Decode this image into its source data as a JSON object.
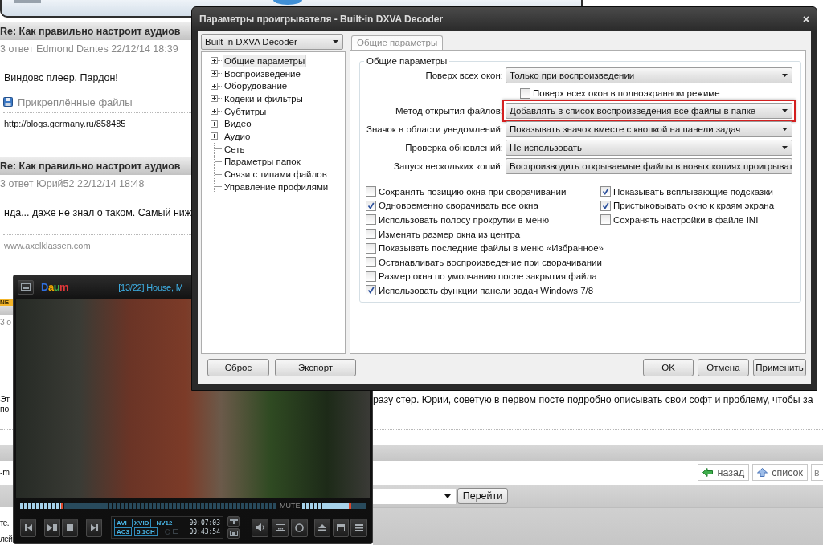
{
  "forum": {
    "posts": [
      {
        "title": "Re: Как правильно настроит аудиов",
        "meta": "3 ответ Edmond Dantes 22/12/14 18:39",
        "body": "Виндовс плеер. Пардон!",
        "attachments": "Прикреплённые файлы",
        "signature": {
          "text": "http://blogs.germany.ru/858485",
          "muted": false
        }
      },
      {
        "title": "Re: Как правильно настроит аудиов",
        "meta": "3 ответ Юрий52 22/12/14 18:48",
        "body": "нда... даже не знал о таком. Самый ниж",
        "signature": {
          "text": "www.axelklassen.com",
          "muted": true
        }
      }
    ],
    "new_badge": "NE",
    "next_post": {
      "meta": "3 о",
      "lines": [
        {
          "left": "Эт",
          "right": "разу стер. Юрии, советую в первом посте подробно описывать свои софт и проблему, чтобы за"
        },
        {
          "left": "по"
        }
      ]
    },
    "nav": {
      "fragment": "-m",
      "buttons": [
        {
          "kind": "back",
          "label": "назад"
        },
        {
          "kind": "list",
          "label": "список"
        },
        {
          "kind": "plain",
          "label": "в"
        }
      ]
    },
    "jump_button": "Перейти",
    "footer_fragments": [
      "те.",
      "лей"
    ]
  },
  "dialog": {
    "title": "Параметры проигрывателя - Built-in DXVA Decoder",
    "profile": "Built-in DXVA Decoder",
    "tree": [
      {
        "label": "Общие параметры",
        "kind": "branch",
        "selected": true
      },
      {
        "label": "Воспроизведение",
        "kind": "branch",
        "selected": false
      },
      {
        "label": "Оборудование",
        "kind": "branch",
        "selected": false
      },
      {
        "label": "Кодеки и фильтры",
        "kind": "branch",
        "selected": false
      },
      {
        "label": "Субтитры",
        "kind": "branch",
        "selected": false
      },
      {
        "label": "Видео",
        "kind": "branch",
        "selected": false
      },
      {
        "label": "Аудио",
        "kind": "branch",
        "selected": false
      },
      {
        "label": "Сеть",
        "kind": "leaf",
        "selected": false
      },
      {
        "label": "Параметры папок",
        "kind": "leaf",
        "selected": false
      },
      {
        "label": "Связи с типами файлов",
        "kind": "leaf",
        "selected": false
      },
      {
        "label": "Управление профилями",
        "kind": "leaf",
        "selected": false
      }
    ],
    "tabs": [
      {
        "label": "Общие параметры",
        "selected": true
      }
    ],
    "group_title": "Общие параметры",
    "rows": [
      {
        "kind": "dropdown",
        "label": "Поверх всех окон:",
        "value": "Только при воспроизведении",
        "highlighted": false
      },
      {
        "kind": "checkbox",
        "label": "Поверх всех окон в полноэкранном режиме",
        "checked": false
      },
      {
        "kind": "dropdown",
        "label": "Метод открытия файлов:",
        "value": "Добавлять в список воспроизведения все файлы в папке",
        "highlighted": true
      },
      {
        "kind": "dropdown",
        "label": "Значок в области уведомлений:",
        "value": "Показывать значок вместе с кнопкой на панели задач",
        "highlighted": false
      },
      {
        "kind": "dropdown",
        "label": "Проверка обновлений:",
        "value": "Не использовать",
        "highlighted": false
      },
      {
        "kind": "dropdown",
        "label": "Запуск нескольких копий:",
        "value": "Воспроизводить открываемые файлы в новых копиях проигрыват",
        "highlighted": false
      }
    ],
    "options_left": [
      {
        "label": "Сохранять позицию окна при сворачивании",
        "checked": false
      },
      {
        "label": "Одновременно сворачивать все окна",
        "checked": true
      },
      {
        "label": "Использовать полосу прокрутки в меню",
        "checked": false
      },
      {
        "label": "Изменять размер окна из центра",
        "checked": false
      },
      {
        "label": "Показывать последние файлы в меню «Избранное»",
        "checked": false
      },
      {
        "label": "Останавливать воспроизведение при сворачивании",
        "checked": false
      },
      {
        "label": "Размер окна по умолчанию после закрытия файла",
        "checked": false
      },
      {
        "label": "Использовать функции панели задач Windows 7/8",
        "checked": true
      }
    ],
    "options_right": [
      {
        "label": "Показывать всплывающие подсказки",
        "checked": true
      },
      {
        "label": "Пристыковывать окно к краям экрана",
        "checked": true
      },
      {
        "label": "Сохранять настройки в файле INI",
        "checked": false
      }
    ],
    "buttons_left": [
      "Сброс",
      "Экспорт"
    ],
    "buttons_right": [
      "OK",
      "Отмена",
      "Применить"
    ]
  },
  "player": {
    "logo": "Daum",
    "title": "[13/22] House, M",
    "seek": {
      "level": 0.17
    },
    "mute_label": "MUTE",
    "volume": {
      "level": 0.77
    },
    "video_tags": [
      "AVI",
      "XVID",
      "NV12"
    ],
    "audio_tags": [
      "AC3",
      "5.1CH"
    ],
    "elapsed": "00:07:03",
    "duration": "00:43:54"
  }
}
